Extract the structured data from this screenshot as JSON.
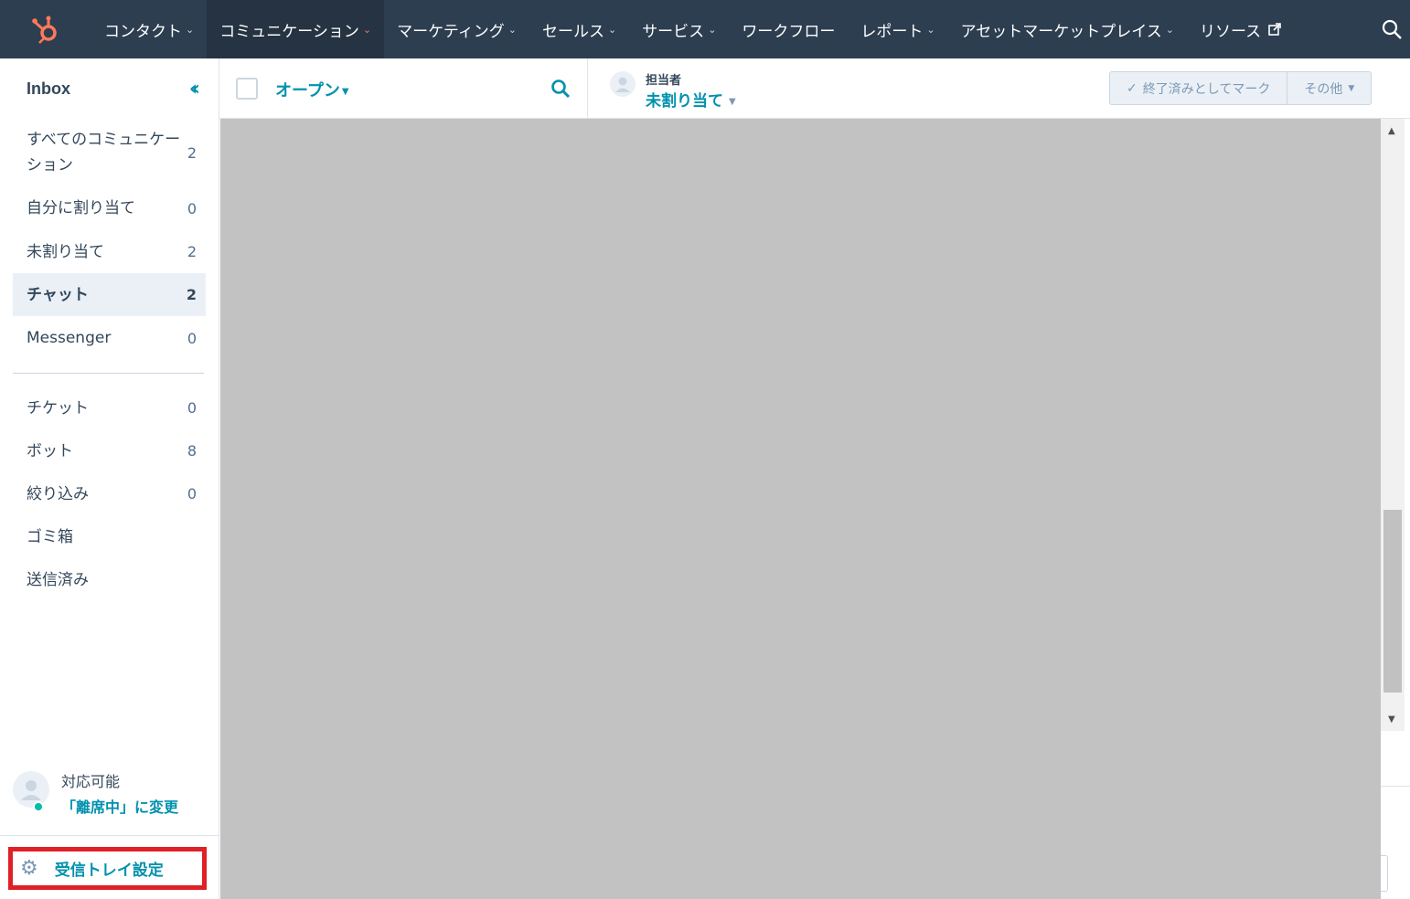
{
  "topnav": {
    "items": [
      {
        "label": "コンタクト",
        "has_menu": true
      },
      {
        "label": "コミュニケーション",
        "has_menu": true,
        "active": true
      },
      {
        "label": "マーケティング",
        "has_menu": true
      },
      {
        "label": "セールス",
        "has_menu": true
      },
      {
        "label": "サービス",
        "has_menu": true
      },
      {
        "label": "ワークフロー",
        "has_menu": false
      },
      {
        "label": "レポート",
        "has_menu": true
      },
      {
        "label": "アセットマーケットプレイス",
        "has_menu": true
      },
      {
        "label": "リソース",
        "has_menu": false,
        "external": true
      }
    ],
    "brand_color": "#ff7a59",
    "bg_color": "#2d3e50"
  },
  "sidebar": {
    "title": "Inbox",
    "items": [
      {
        "label": "すべてのコミュニケーション",
        "count": "2"
      },
      {
        "label": "自分に割り当て",
        "count": "0"
      },
      {
        "label": "未割り当て",
        "count": "2"
      },
      {
        "label": "チャット",
        "count": "2",
        "active": true
      },
      {
        "label": "Messenger",
        "count": "0"
      }
    ],
    "items2": [
      {
        "label": "チケット",
        "count": "0"
      },
      {
        "label": "ボット",
        "count": "8"
      },
      {
        "label": "絞り込み",
        "count": "0"
      },
      {
        "label": "ゴミ箱",
        "count": ""
      },
      {
        "label": "送信済み",
        "count": ""
      }
    ],
    "status_label": "対応可能",
    "status_link": "「離席中」に変更",
    "settings_label": "受信トレイ設定"
  },
  "toolbar": {
    "filter_label": "オープン",
    "owner_label": "担当者",
    "owner_value": "未割り当て",
    "mark_done_label": "終了済みとしてマーク",
    "more_label": "その他"
  },
  "colors": {
    "accent": "#0091ae",
    "highlight": "#e01f26",
    "online": "#00bda5"
  }
}
